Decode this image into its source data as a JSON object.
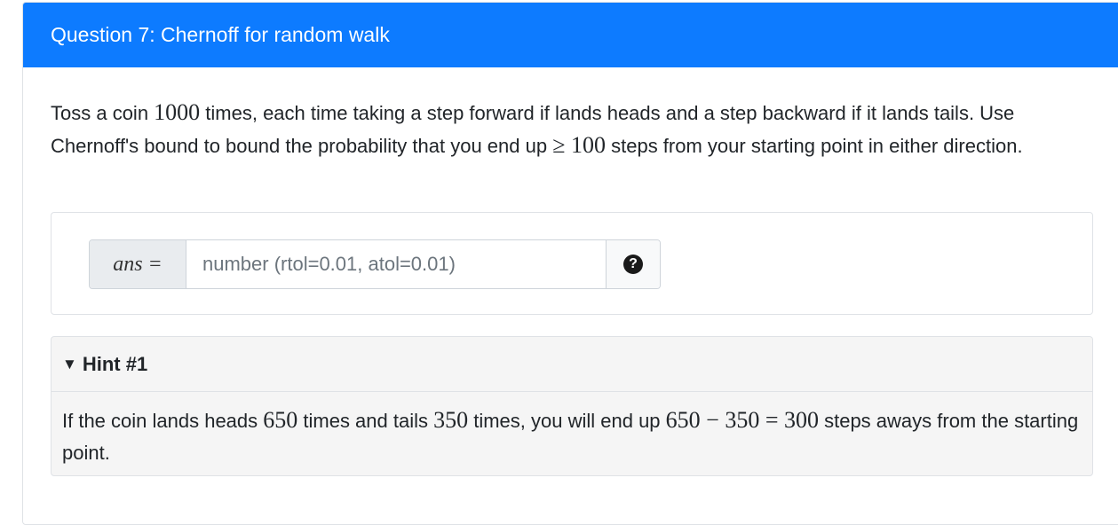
{
  "question": {
    "title": "Question 7: Chernoff for random walk",
    "text_1": "Toss a coin ",
    "math_1": "1000",
    "text_2": " times, each time taking a step forward if lands heads and a step backward if it lands tails. Use Chernoff's bound to bound the probability that you end up ",
    "math_2": "≥ 100",
    "text_3": " steps from your starting point in either direction."
  },
  "answer": {
    "prefix_label": "ans =",
    "placeholder": "number (rtol=0.01, atol=0.01)",
    "value": "",
    "help_icon": "question-circle-icon"
  },
  "hint": {
    "summary": "Hint #1",
    "text_1": "If the coin lands heads ",
    "math_1": "650",
    "text_2": " times and tails ",
    "math_2": "350",
    "text_3": " times, you will end up ",
    "math_3": "650 − 350 = 300",
    "text_4": " steps aways from the starting point."
  },
  "colors": {
    "header_bg": "#0d7bff",
    "hint_bg": "#f5f5f5"
  }
}
